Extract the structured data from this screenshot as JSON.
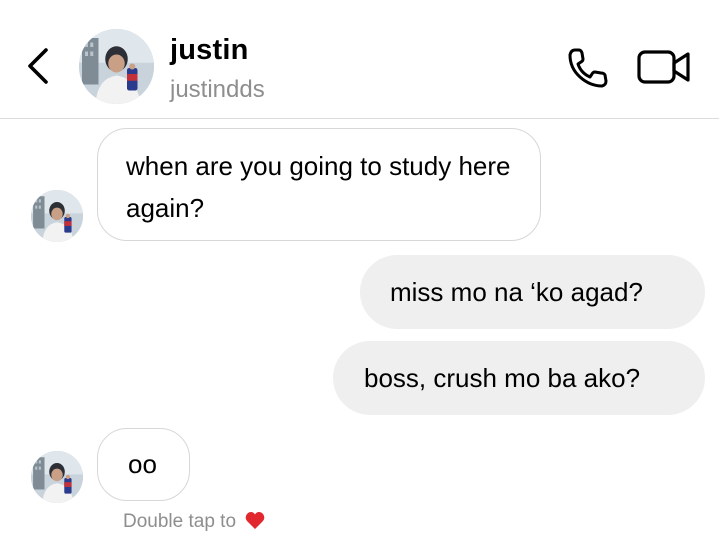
{
  "header": {
    "name": "justin",
    "username": "justindds",
    "back_icon": "chevron-left-icon",
    "call_icon": "phone-icon",
    "video_icon": "video-camera-icon"
  },
  "messages": [
    {
      "direction": "incoming",
      "text": "when are you going to study here again?"
    },
    {
      "direction": "outgoing",
      "text": "miss mo na ‘ko agad?"
    },
    {
      "direction": "outgoing",
      "text": "boss, crush mo ba ako?"
    },
    {
      "direction": "incoming",
      "text": "oo"
    }
  ],
  "footer": {
    "hint": "Double tap to",
    "hint_icon": "heart-icon"
  },
  "colors": {
    "incoming_border": "#d7d7d7",
    "outgoing_bg": "#efefef",
    "secondary_text": "#8e8e8e",
    "heart": "#e0282e"
  }
}
